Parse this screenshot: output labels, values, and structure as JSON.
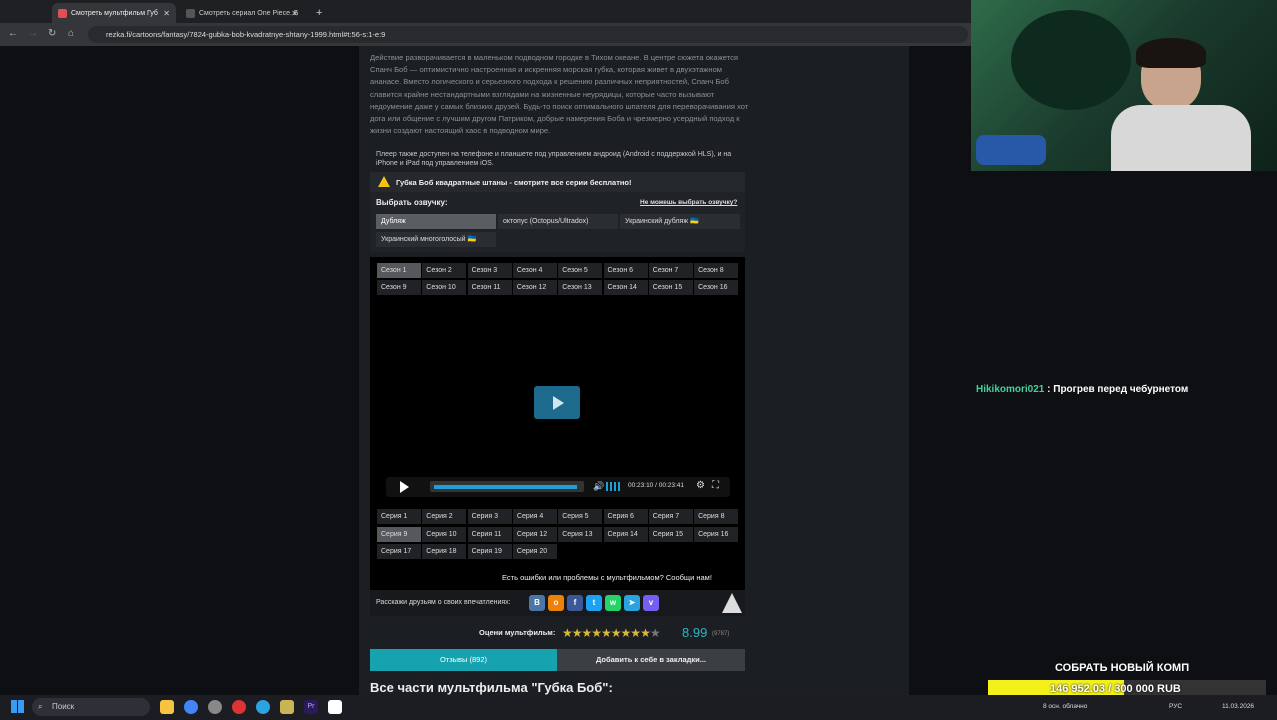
{
  "browser": {
    "tabs": [
      {
        "title": "Смотреть мультфильм Губ"
      },
      {
        "title": "Смотреть сериал One Piece. Б"
      }
    ],
    "url": "rezka.fi/cartoons/fantasy/7824-gubka-bob-kvadratnye-shtany-1999.html#t:56-s:1-e:9"
  },
  "page": {
    "description": "Действие разворачивается в маленьком подводном городке в Тихом океане. В центре сюжета окажется Спанч Боб — оптимистично настроенная и искренняя морская губка, которая живет в двухэтажном ананасе. Вместо логического и серьезного подхода к решению различных неприятностей, Спанч Боб славится крайне нестандартными взглядами на жизненные неурядицы, которые часто вызывают недоумение даже у самых близких друзей. Будь-то поиск оптимального шпателя для переворачивания хот дога или общение с лучшим другом Патриком, добрые намерения Боба и чрезмерно усердный подход к жизни создают настоящий хаос в подводном мире.",
    "player_note": "Плеер также доступен на телефоне и планшете под управлением андроид (Android с поддержкой HLS), и на iPhone и iPad под управлением iOS.",
    "warning": "Губка Боб квадратные штаны - смотрите все серии бесплатно!",
    "voice_label": "Выбрать озвучку:",
    "cant_choose": "Не можешь выбрать озвучку?",
    "voices": [
      "Дубляж",
      "октопус (Octopus/Ultradox)",
      "Украинский дубляж 🇺🇦",
      "Украинский многоголосый 🇺🇦"
    ],
    "seasons": [
      "Сезон 1",
      "Сезон 2",
      "Сезон 3",
      "Сезон 4",
      "Сезон 5",
      "Сезон 6",
      "Сезон 7",
      "Сезон 8",
      "Сезон 9",
      "Сезон 10",
      "Сезон 11",
      "Сезон 12",
      "Сезон 13",
      "Сезон 14",
      "Сезон 15",
      "Сезон 16"
    ],
    "time": "00:23:10 / 00:23:41",
    "progress": 0.98,
    "episodes": [
      "Серия 1",
      "Серия 2",
      "Серия 3",
      "Серия 4",
      "Серия 5",
      "Серия 6",
      "Серия 7",
      "Серия 8",
      "Серия 9",
      "Серия 10",
      "Серия 11",
      "Серия 12",
      "Серия 13",
      "Серия 14",
      "Серия 15",
      "Серия 16",
      "Серия 17",
      "Серия 18",
      "Серия 19",
      "Серия 20"
    ],
    "error_text": "Есть ошибки или проблемы с мультфильмом? Сообщи нам!",
    "share_label": "Расскажи друзьям о своих впечатлениях:",
    "rating_label": "Оцени мультфильм:",
    "rating": "8.99",
    "votes": "(9787)",
    "reviews_tab": "Отзывы (892)",
    "bookmark_tab": "Добавить к себе в закладки...",
    "all_parts": "Все части мультфильма \"Губка Боб\":"
  },
  "stream": {
    "chat_user": "Hikikomori021",
    "chat_msg": ": Прогрев перед чебурнетом",
    "goal_title": "СОБРАТЬ НОВЫЙ КОМП",
    "goal_text": "146 952.03 / 300 000 RUB",
    "goal_fraction": 0.49
  },
  "taskbar": {
    "search": "Поиск",
    "weather": "8 осн. облачно",
    "lang": "РУС",
    "date": "11.03.2026"
  }
}
